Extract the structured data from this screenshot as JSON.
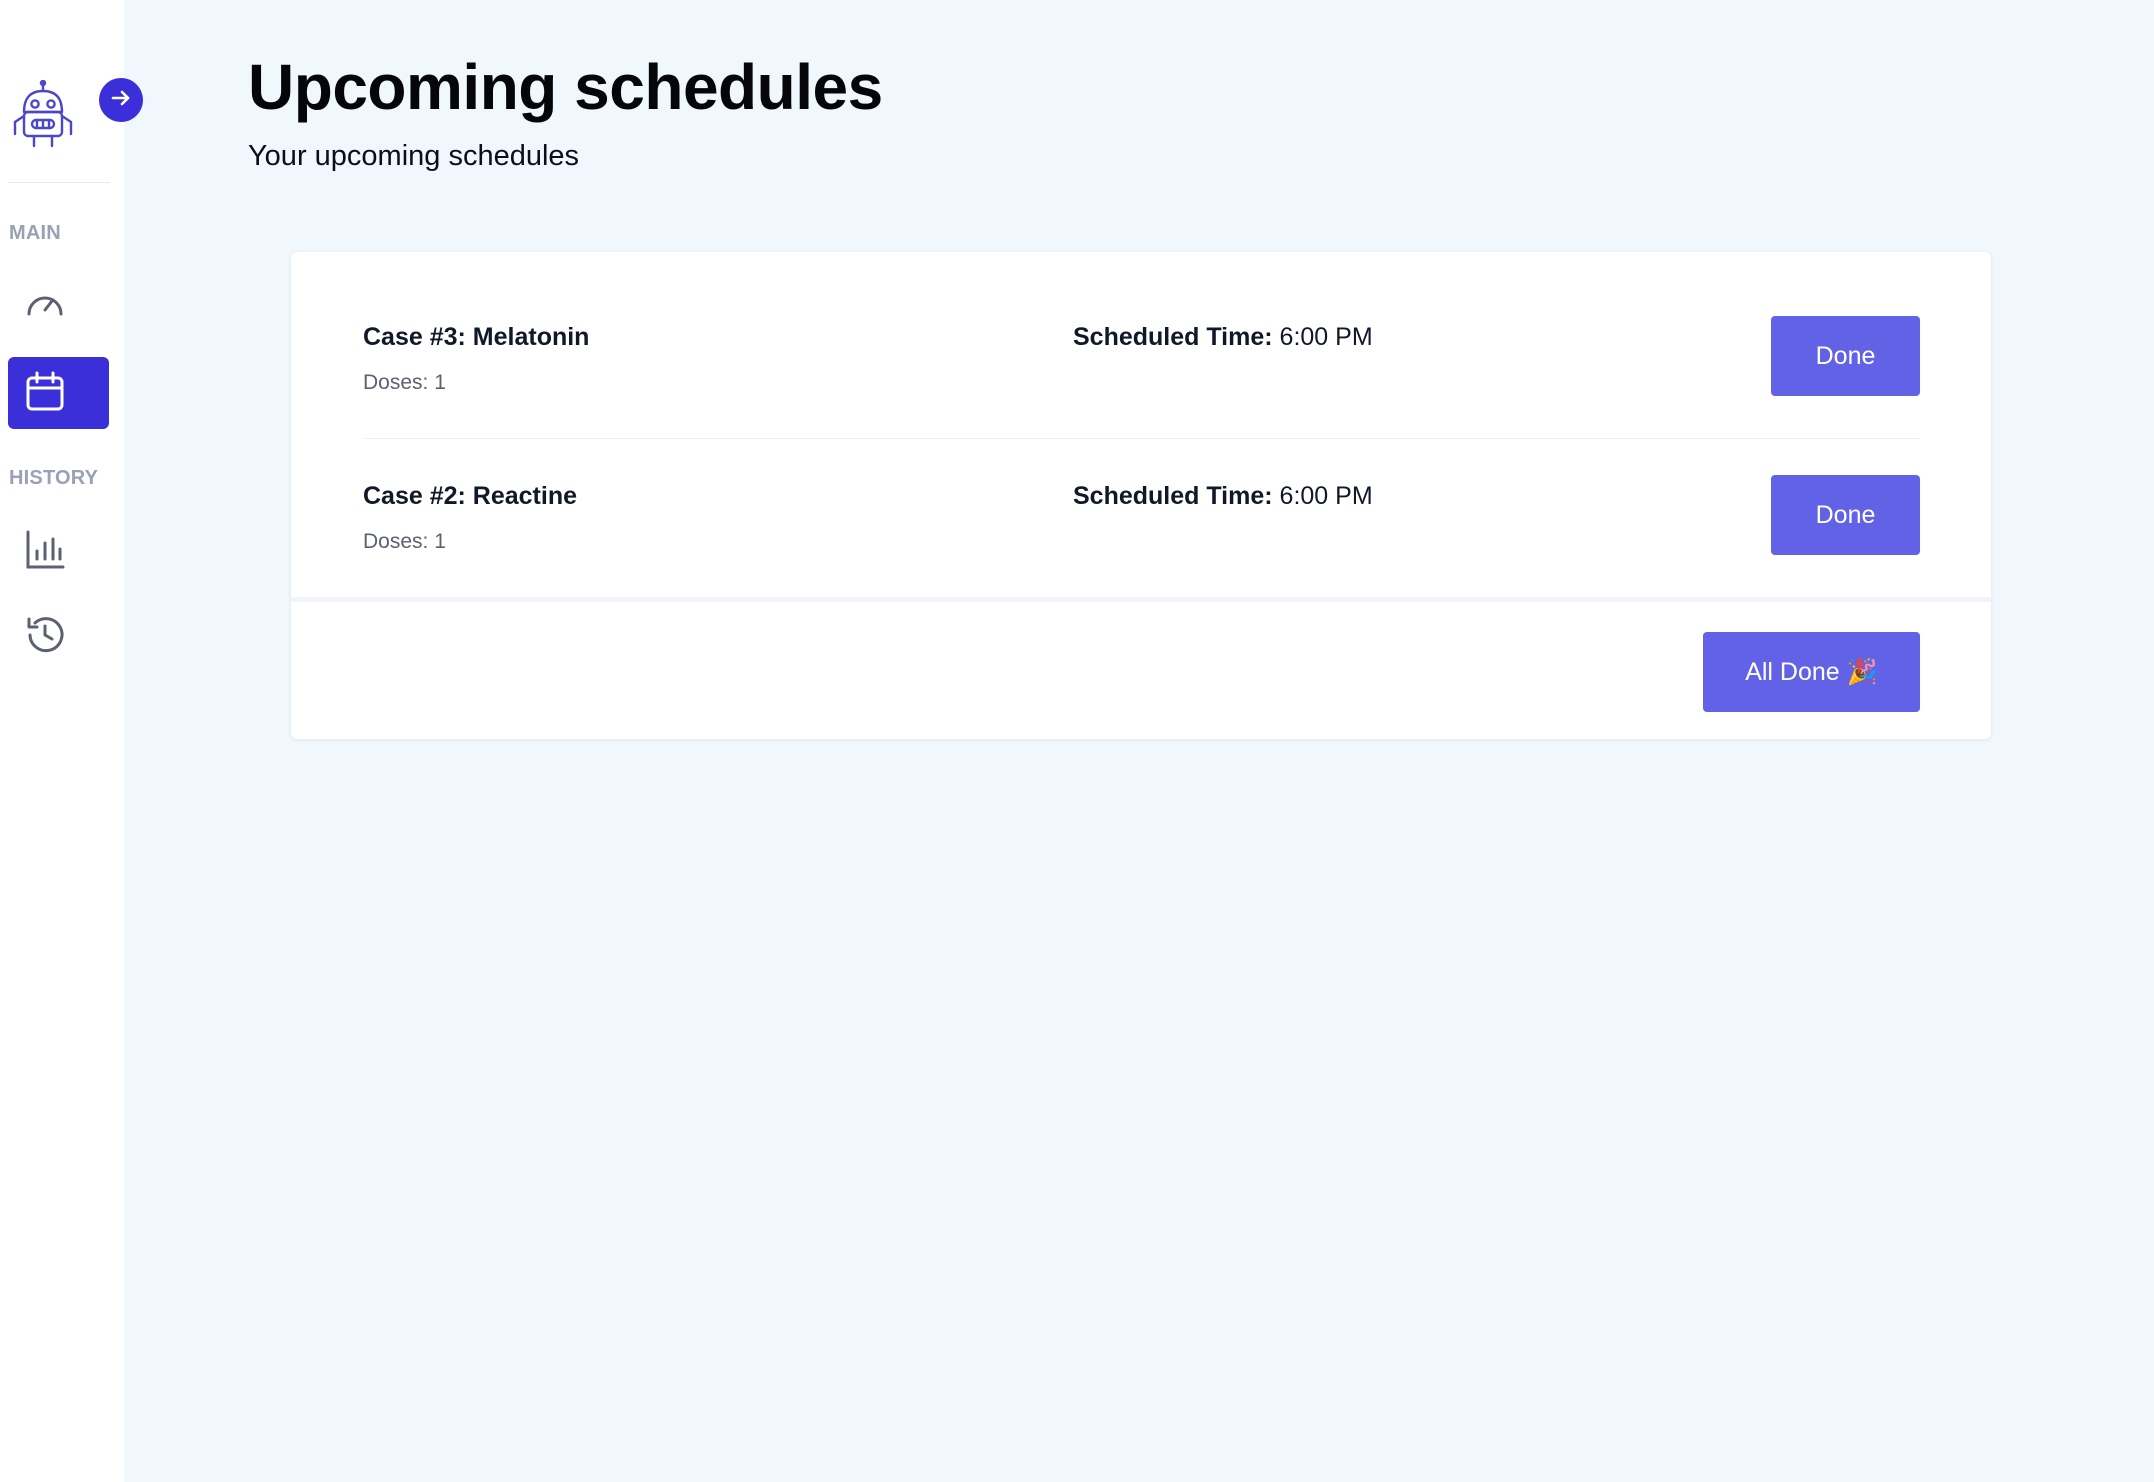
{
  "sidebar": {
    "logo_icon": "robot-icon",
    "expand_icon": "arrow-right-icon",
    "sections": {
      "main_label": "MAIN",
      "history_label": "HISTORY"
    },
    "items": [
      {
        "icon": "speedometer-icon",
        "active": false
      },
      {
        "icon": "calendar-icon",
        "active": true
      },
      {
        "icon": "bar-chart-icon",
        "active": false
      },
      {
        "icon": "history-icon",
        "active": false
      }
    ]
  },
  "header": {
    "title": "Upcoming schedules",
    "subtitle": "Your upcoming schedules"
  },
  "schedules": [
    {
      "case": "Case #3: Melatonin",
      "doses": "Doses: 1",
      "time_label": "Scheduled Time:",
      "time_value": " 6:00 PM",
      "button": "Done"
    },
    {
      "case": "Case #2: Reactine",
      "doses": "Doses: 1",
      "time_label": "Scheduled Time:",
      "time_value": " 6:00 PM",
      "button": "Done"
    }
  ],
  "footer": {
    "all_done_label": "All Done 🎉"
  },
  "colors": {
    "accent": "#3a2fd8",
    "button": "#6262e6",
    "background": "#f0f7fd"
  }
}
